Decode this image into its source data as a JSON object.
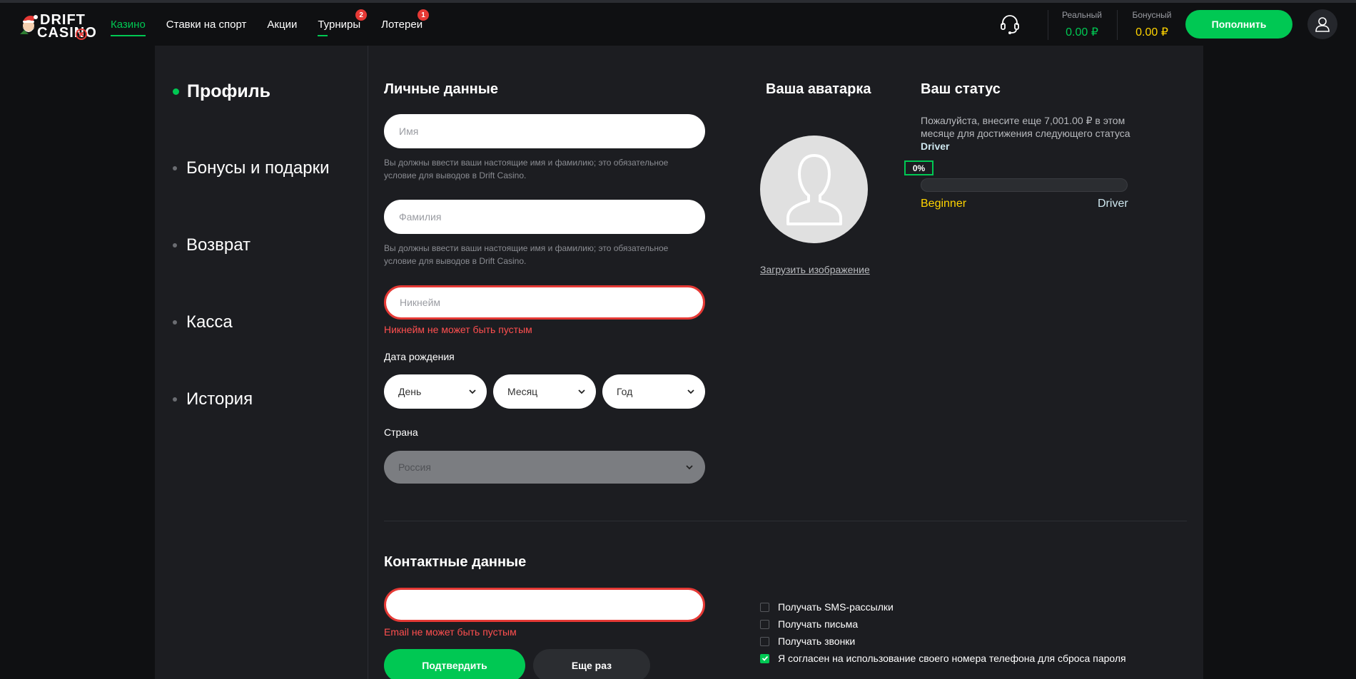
{
  "header": {
    "logo": {
      "line1": "DRIFT",
      "line2": "CASINO"
    },
    "nav": [
      {
        "label": "Казино",
        "active": true
      },
      {
        "label": "Ставки на спорт"
      },
      {
        "label": "Акции"
      },
      {
        "label": "Турниры",
        "badge": "2"
      },
      {
        "label": "Лотереи",
        "badge": "1"
      }
    ],
    "balance_real": {
      "label": "Реальный",
      "value": "0.00 ₽",
      "color": "#00c853"
    },
    "balance_bonus": {
      "label": "Бонусный",
      "value": "0.00 ₽",
      "color": "#ffd400"
    },
    "deposit_label": "Пополнить",
    "icons": {
      "support": "headset-icon",
      "user": "user-icon"
    }
  },
  "sidebar": {
    "items": [
      {
        "label": "Профиль",
        "active": true
      },
      {
        "label": "Бонусы и подарки"
      },
      {
        "label": "Возврат"
      },
      {
        "label": "Касса"
      },
      {
        "label": "История"
      }
    ]
  },
  "personal": {
    "title": "Личные данные",
    "first_name_placeholder": "Имя",
    "first_name_hint": "Вы должны ввести ваши настоящие имя и фамилию; это обязательное условие для выводов в Drift Casino.",
    "last_name_placeholder": "Фамилия",
    "last_name_hint": "Вы должны ввести ваши настоящие имя и фамилию; это обязательное условие для выводов в Drift Casino.",
    "nickname_placeholder": "Никнейм",
    "nickname_error": "Никнейм не может быть пустым",
    "dob_label": "Дата рождения",
    "dob_day": "День",
    "dob_month": "Месяц",
    "dob_year": "Год",
    "country_label": "Страна",
    "country_value": "Россия"
  },
  "avatar": {
    "title": "Ваша аватарка",
    "upload_label": "Загрузить изображение"
  },
  "status": {
    "title": "Ваш статус",
    "text_before": "Пожалуйста, внесите еще 7,001.00 ₽ в этом месяце для достижения следующего статуса ",
    "text_next": "Driver",
    "progress_label": "0%",
    "progress": 0,
    "current_level": "Beginner",
    "next_level": "Driver",
    "current_color": "#ffd400",
    "next_color": "#cfe8f0"
  },
  "contacts": {
    "title": "Контактные данные",
    "email_value": "",
    "email_error": "Email не может быть пустым",
    "confirm_label": "Подтвердить",
    "again_label": "Еще раз",
    "checkboxes": [
      {
        "label": "Получать SMS-рассылки",
        "checked": false
      },
      {
        "label": "Получать письма",
        "checked": false
      },
      {
        "label": "Получать звонки",
        "checked": false
      },
      {
        "label": "Я согласен на использование своего номера телефона для сброса пароля",
        "checked": true
      }
    ]
  }
}
